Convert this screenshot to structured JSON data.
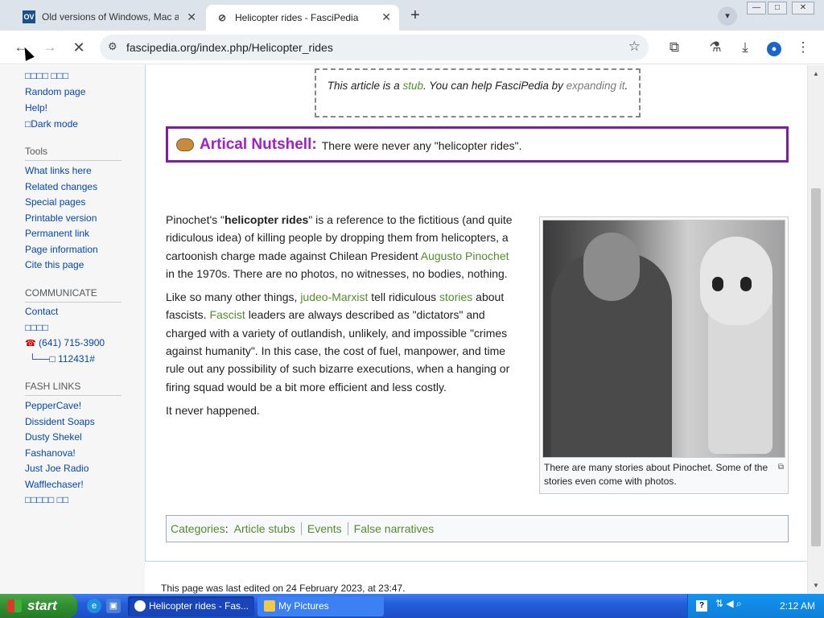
{
  "browser": {
    "tabs": [
      {
        "favicon": "OV",
        "title": "Old versions of Windows, Mac and"
      },
      {
        "favicon": "⊘",
        "title": "Helicopter rides - FasciPedia"
      }
    ],
    "new_tab_label": "+",
    "window_buttons": {
      "minimize": "—",
      "maximize": "□",
      "close": "✕"
    },
    "url": "fascipedia.org/index.php/Helicopter_rides",
    "icons": [
      "back-arrow-icon",
      "forward-arrow-icon",
      "stop-loading-icon",
      "site-info-icon",
      "bookmark-star-icon",
      "extensions-icon",
      "labs-flask-icon",
      "download-icon",
      "profile-icon",
      "kebab-menu-icon"
    ]
  },
  "sidebar": {
    "top_links": [
      "□□□□ □□□",
      "Random page",
      "Help!",
      "□Dark mode"
    ],
    "tools_heading": "Tools",
    "tools_links": [
      "What links here",
      "Related changes",
      "Special pages",
      "Printable version",
      "Permanent link",
      "Page information",
      "Cite this page"
    ],
    "communicate_heading": "COMMUNICATE",
    "communicate_links": [
      "Contact",
      "□□□□"
    ],
    "phone": "(641) 715-3900",
    "extension": "└──□ 112431#",
    "fash_heading": "FASH LINKS",
    "fash_links": [
      "PepperCave!",
      "Dissident Soaps",
      "Dusty Shekel",
      "Fashanova!",
      "Just Joe Radio",
      "Wafflechaser!",
      "□□□□□ □□"
    ]
  },
  "article": {
    "stub": {
      "before": "This article is a ",
      "stub_link": "stub",
      "middle": ". You can help FasciPedia by ",
      "expand_link": "expanding it",
      "after": "."
    },
    "nutshell": {
      "label": "Artical Nutshell:",
      "text": "There were never any \"helicopter rides\"."
    },
    "p1": {
      "a": "Pinochet's \"",
      "bold": "helicopter rides",
      "b": "\" is a reference to the fictitious (and quite ridiculous idea) of killing people by dropping them from helicopters, a cartoonish charge made against Chilean President ",
      "link": "Augusto Pinochet",
      "c": " in the 1970s. There are no photos, no witnesses, no bodies, nothing."
    },
    "p2": {
      "a": "Like so many other things, ",
      "link1": "judeo-Marxist",
      "b": " tell ridiculous ",
      "link2": "stories",
      "c": " about fascists. ",
      "link3": "Fascist",
      "d": " leaders are always described as \"dictators\" and charged with a variety of outlandish, unlikely, and impossible \"crimes against humanity\". In this case, the cost of fuel, manpower, and time rule out any possibility of such bizarre executions, when a hanging or firing squad would be a bit more efficient and less costly."
    },
    "p3": "It never happened.",
    "figure_caption": "There are many stories about Pinochet. Some of the stories even come with photos.",
    "categories": {
      "label": "Categories",
      "items": [
        "Article stubs",
        "Events",
        "False narratives"
      ]
    },
    "footer": "This page was last edited on 24 February 2023, at 23:47."
  },
  "taskbar": {
    "start_label": "start",
    "tasks": [
      "Helicopter rides - Fas...",
      "My Pictures"
    ],
    "tray_help": "?",
    "clock": "2:12 AM"
  },
  "colors": {
    "link": "#0645ad",
    "article_link": "#558b2f",
    "nutshell_border": "#7b1fa2",
    "nutshell_label": "#a020c8"
  }
}
